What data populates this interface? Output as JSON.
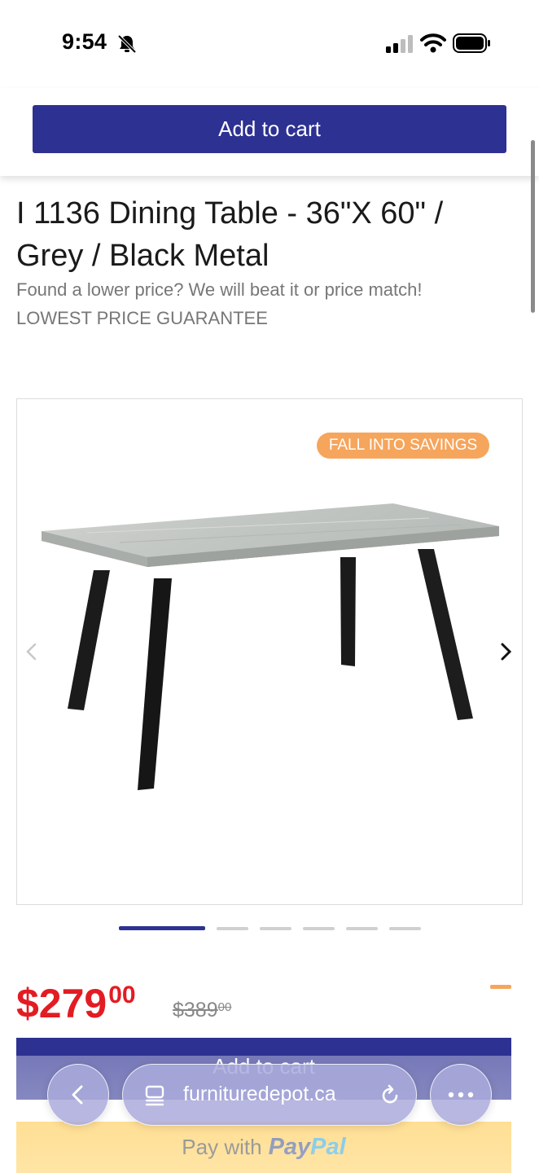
{
  "status_bar": {
    "time": "9:54",
    "icons": [
      "bell-slash-icon",
      "cellular-signal-icon",
      "wifi-icon",
      "battery-icon"
    ]
  },
  "sticky_header": {
    "add_to_cart_label": "Add to cart"
  },
  "product": {
    "title": "I 1136 Dining Table - 36\"X 60\" / Grey / Black Metal",
    "price_match": "Found a lower price? We will beat it or price match!",
    "guarantee": "LOWEST PRICE GUARANTEE"
  },
  "gallery": {
    "badge": "FALL INTO SAVINGS",
    "image_count": 6,
    "active_index": 0,
    "prev_icon": "chevron-left-icon",
    "next_icon": "chevron-right-icon"
  },
  "pricing": {
    "sale_dollars": "$279",
    "sale_cents": "00",
    "was_dollars": "$389",
    "was_cents": "00"
  },
  "actions": {
    "add_to_cart_label": "Add to cart",
    "paypal_prefix": "Pay with",
    "paypal_brand_1": "Pay",
    "paypal_brand_2": "Pal"
  },
  "browser": {
    "url": "furnituredepot.ca",
    "icons": [
      "back-arrow-icon",
      "tabs-icon",
      "reload-icon",
      "more-icon"
    ]
  },
  "colors": {
    "brand_navy": "#2d3192",
    "sale_red": "#e31c23",
    "badge_orange": "#f6a55c",
    "paypal_yellow": "#ffc439"
  }
}
